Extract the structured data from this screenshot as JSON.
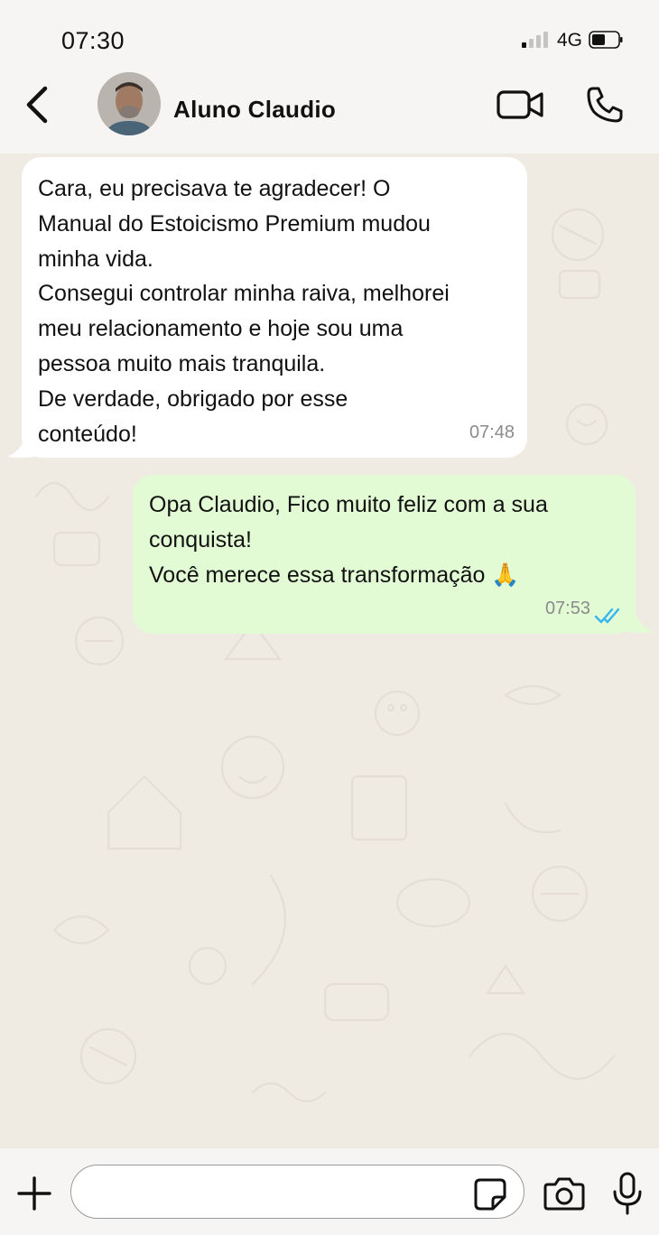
{
  "status_bar": {
    "time": "07:30",
    "network": "4G",
    "icons": [
      "signal-icon",
      "battery-icon"
    ]
  },
  "header": {
    "contact_name": "Aluno Claudio",
    "icons": [
      "back-arrow-icon",
      "avatar",
      "video-call-icon",
      "phone-icon"
    ]
  },
  "messages": [
    {
      "direction": "incoming",
      "text": "Cara, eu precisava te agradecer! O\nManual do Estoicismo Premium mudou\nminha vida.\nConsegui controlar minha raiva, melhorei\nmeu relacionamento e hoje sou uma\npessoa muito mais tranquila.\nDe verdade, obrigado por esse\nconteúdo!",
      "time": "07:48"
    },
    {
      "direction": "outgoing",
      "text": "Opa Claudio, Fico muito feliz com a sua\nconquista!\nVocê merece essa transformação 🙏",
      "time": "07:53",
      "status": "read",
      "status_color": "#34B7F1"
    }
  ],
  "composer": {
    "value": "",
    "icons": [
      "plus-icon",
      "sticker-icon",
      "camera-icon",
      "microphone-icon"
    ]
  },
  "colors": {
    "incoming_bubble": "#ffffff",
    "outgoing_bubble": "#e2fbd4",
    "chat_background": "#efeae2"
  }
}
